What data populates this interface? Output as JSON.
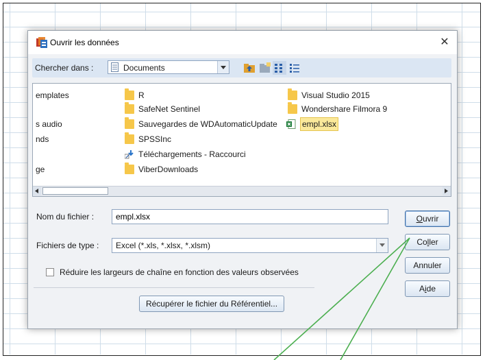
{
  "dialog": {
    "title": "Ouvrir les données",
    "close_glyph": "✕",
    "look_in_label": "Chercher dans :",
    "look_in_value": "Documents"
  },
  "files": {
    "col1_partial": [
      "emplates",
      "s audio",
      "nds",
      "ge"
    ],
    "col2": [
      "R",
      "SafeNet Sentinel",
      "Sauvegardes de WDAutomaticUpdate",
      "SPSSInc",
      "Téléchargements - Raccourci",
      "ViberDownloads"
    ],
    "col3": [
      "Visual Studio 2015",
      "Wondershare Filmora 9"
    ],
    "selected_file": "empl.xlsx"
  },
  "form": {
    "filename_label": "Nom du fichier :",
    "filename_value": "empl.xlsx",
    "filetype_label": "Fichiers de type :",
    "filetype_value": "Excel (*.xls, *.xlsx, *.xlsm)",
    "reduce_label": "Réduire les largeurs de chaîne en fonction des valeurs observées",
    "reduce_checked": false,
    "repository_button": "Récupérer le fichier du Référentiel..."
  },
  "buttons": {
    "open_first": "O",
    "open_rest": "uvrir",
    "paste_a": "Co",
    "paste_u": "l",
    "paste_b": "ler",
    "cancel": "Annuler",
    "help_a": "A",
    "help_u": "i",
    "help_b": "de"
  },
  "colors": {
    "accent_border": "#3f6fa8",
    "toolbar_bg": "#dbe6f3",
    "selection_bg": "#fbe99a",
    "folder": "#f6c74a",
    "annotation_line": "#4caf50"
  }
}
